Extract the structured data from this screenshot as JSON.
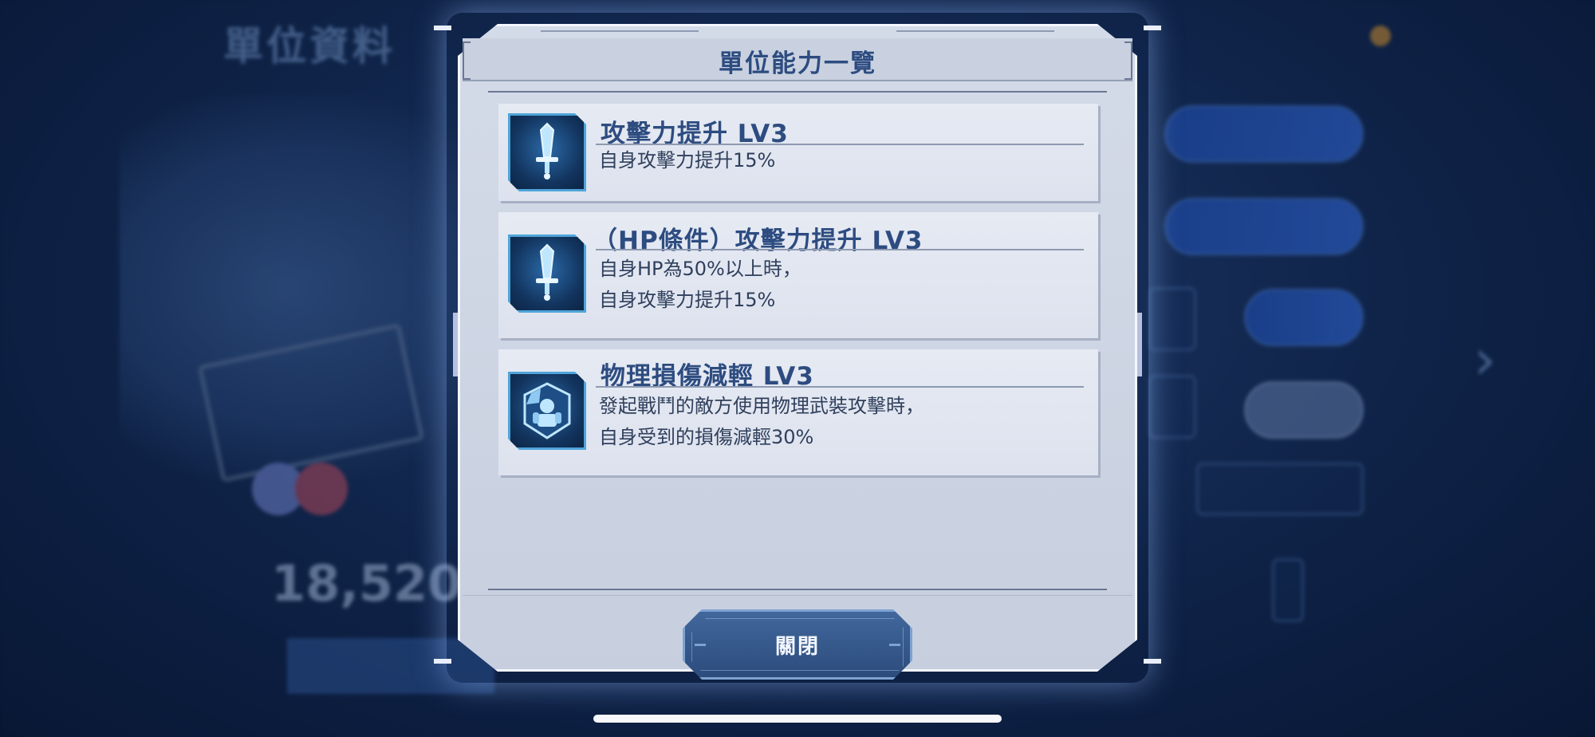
{
  "dialog": {
    "title": "單位能力一覽",
    "close_label": "關閉"
  },
  "abilities": [
    {
      "icon": "sword-icon",
      "name": "攻擊力提升 LV3",
      "description": [
        "自身攻擊力提升15%"
      ]
    },
    {
      "icon": "sword-icon",
      "name": "（HP條件）攻擊力提升 LV3",
      "description": [
        "自身HP為50%以上時，",
        "自身攻擊力提升15%"
      ]
    },
    {
      "icon": "armor-shield-icon",
      "name": "物理損傷減輕 LV3",
      "description": [
        "發起戰鬥的敵方使用物理武裝攻擊時，",
        "自身受到的損傷減輕30%"
      ]
    }
  ],
  "background": {
    "screen_title": "單位資料",
    "power_value": "18,520"
  },
  "colors": {
    "accent": "#2d4c80",
    "panel": "#d4dbe8",
    "icon_bg": "#12345e",
    "icon_glow": "#4fa4d9"
  }
}
